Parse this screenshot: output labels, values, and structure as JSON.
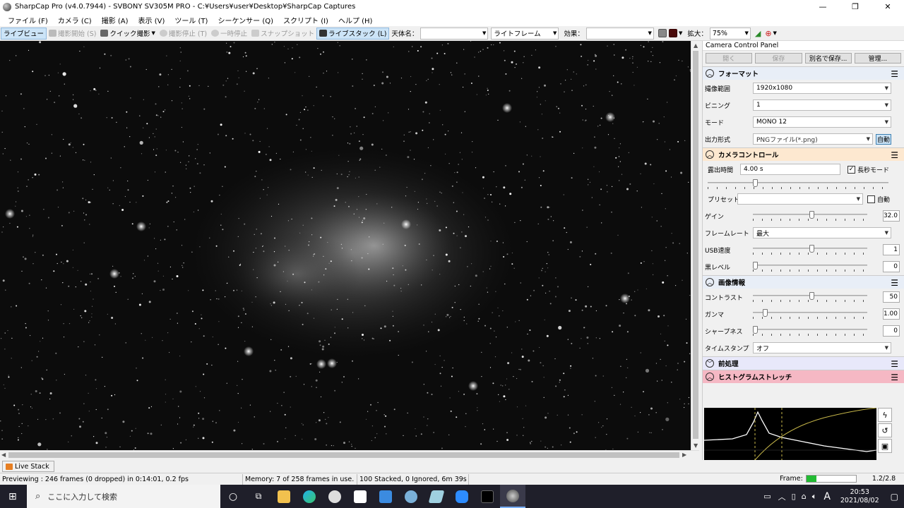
{
  "window": {
    "title": "SharpCap Pro (v4.0.7944) - SVBONY SV305M PRO - C:¥Users¥user¥Desktop¥SharpCap Captures",
    "minimize": "—",
    "maximize": "❐",
    "close": "✕"
  },
  "menu": [
    "ファイル (F)",
    "カメラ (C)",
    "撮影 (A)",
    "表示 (V)",
    "ツール (T)",
    "シーケンサー (Q)",
    "スクリプト (I)",
    "ヘルプ (H)"
  ],
  "toolbar": {
    "live_view": "ライブビュー",
    "start_capture": "撮影開始 (S)",
    "quick_capture": "クイック撮影",
    "stop_capture": "撮影停止 (T)",
    "pause": "一時停止",
    "snapshot": "スナップショット",
    "live_stack": "ライブスタック (L)",
    "target_label": "天体名：",
    "target_value": "",
    "frame_type": "ライトフレーム",
    "effect_label": "効果：",
    "effect_value": "",
    "zoom_label": "拡大：",
    "zoom_value": "75%"
  },
  "panel": {
    "title": "Camera Control Panel",
    "buttons": {
      "open": "開く",
      "save": "保存",
      "save_as": "別名で保存...",
      "manage": "管理..."
    },
    "format": {
      "header": "フォーマット",
      "capture_area_label": "撮像範囲",
      "capture_area": "1920x1080",
      "binning_label": "ビニング",
      "binning": "1",
      "mode_label": "モード",
      "mode": "MONO 12",
      "output_label": "出力形式",
      "output": "PNGファイル(*.png)",
      "auto_btn": "自動"
    },
    "camera": {
      "header": "カメラコントロール",
      "exposure_label": "露出時間",
      "exposure": "4.00 s",
      "long_exposure": "長秒モード",
      "preset_label": "プリセット",
      "preset": "",
      "auto_label": "自動",
      "gain_label": "ゲイン",
      "gain": "32.0",
      "framerate_label": "フレームレート",
      "framerate": "最大",
      "usb_label": "USB速度",
      "usb": "1",
      "black_label": "黒レベル",
      "black": "0"
    },
    "image": {
      "header": "画像情報",
      "contrast_label": "コントラスト",
      "contrast": "50",
      "gamma_label": "ガンマ",
      "gamma": "1.00",
      "sharpness_label": "シャープネス",
      "sharpness": "0",
      "timestamp_label": "タイムスタンプ",
      "timestamp": "オフ"
    },
    "preprocess": {
      "header": "前処理"
    },
    "histogram": {
      "header": "ヒストグラムストレッチ"
    }
  },
  "tabs": {
    "live_stack": "Live Stack"
  },
  "status": {
    "preview": "Previewing : 246 frames (0 dropped) in 0:14:01, 0.2 fps",
    "memory": "Memory: 7 of 258 frames in use.",
    "stacked": "100 Stacked, 0 Ignored, 6m 39s",
    "frame_label": "Frame:",
    "frame_value": "1.2/2.8"
  },
  "taskbar": {
    "search_placeholder": "ここに入力して検索",
    "ime": "A",
    "time": "20:53",
    "date": "2021/08/02"
  },
  "colors": {
    "accent": "#cce4f7",
    "camera_header": "#fde8d0",
    "histogram_header": "#f5b8c4",
    "frame_bar": "#22bb33"
  }
}
